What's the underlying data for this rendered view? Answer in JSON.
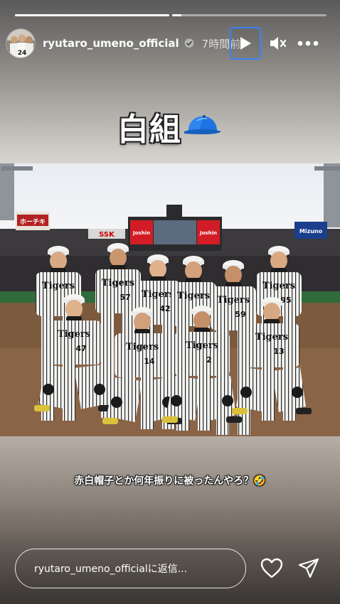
{
  "story": {
    "progress": [
      1.0,
      0.06
    ],
    "username": "ryutaro_umeno_official",
    "time": "7時間前",
    "title_text": "白組",
    "title_emoji_icon": "blue-cap-icon",
    "caption": "赤白帽子とか何年振りに被ったんやろ？🤣",
    "reply_placeholder": "ryutaro_umeno_officialに返信..."
  },
  "photo": {
    "stadium_banners": [
      "Joshin",
      "Joshin",
      "SSK",
      "Mizuno"
    ],
    "jersey_text": "Tigers",
    "back_row_numbers": [
      "57",
      "42",
      "59",
      "95"
    ],
    "front_row_numbers": [
      "47",
      "14",
      "2",
      "13"
    ]
  },
  "avatar": {
    "jersey_number": "24"
  },
  "colors": {
    "accent_focus": "#3b82f6",
    "verified": "#b4b4b4",
    "cap_blue": "#1d74e0"
  }
}
